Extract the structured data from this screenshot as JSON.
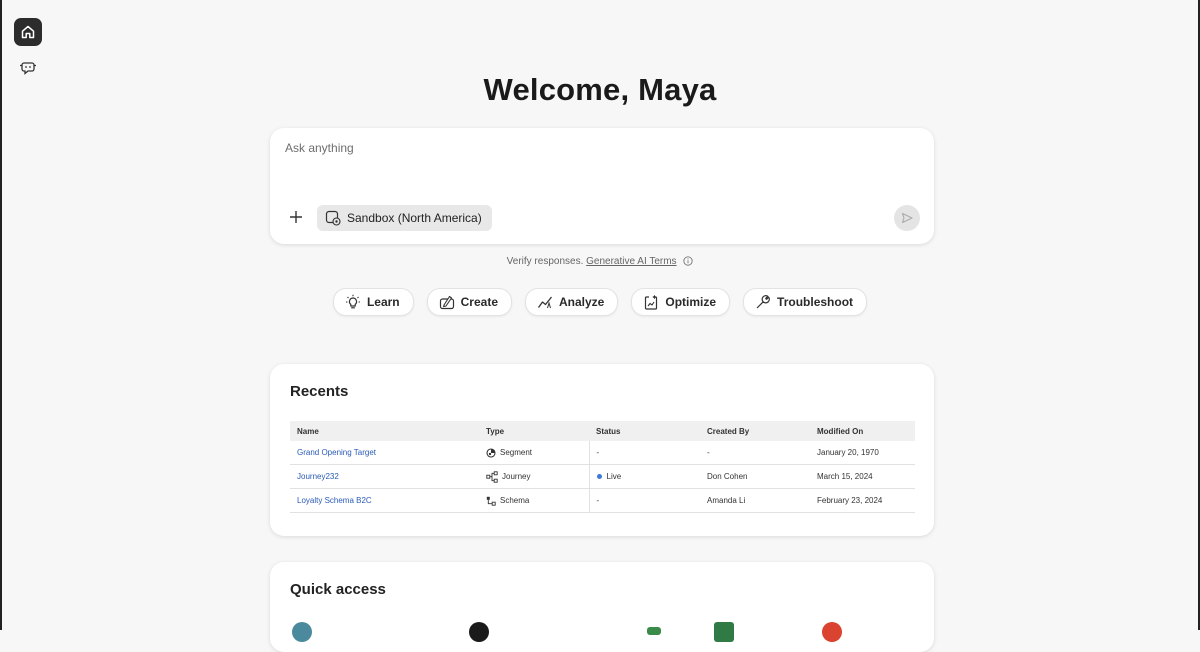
{
  "rail": {
    "items": [
      {
        "icon": "home-icon",
        "active": true
      },
      {
        "icon": "assistant-icon",
        "active": false
      }
    ]
  },
  "welcome": "Welcome, Maya",
  "ask": {
    "placeholder": "Ask anything",
    "sandbox_label": "Sandbox (North America)"
  },
  "verify": {
    "text": "Verify responses.",
    "link": "Generative AI Terms"
  },
  "pills": [
    {
      "label": "Learn",
      "icon": "lightbulb-icon"
    },
    {
      "label": "Create",
      "icon": "create-icon"
    },
    {
      "label": "Analyze",
      "icon": "analyze-icon"
    },
    {
      "label": "Optimize",
      "icon": "optimize-icon"
    },
    {
      "label": "Troubleshoot",
      "icon": "wrench-icon"
    }
  ],
  "recents": {
    "title": "Recents",
    "columns": [
      "Name",
      "Type",
      "Status",
      "Created By",
      "Modified On"
    ],
    "rows": [
      {
        "name": "Grand Opening Target",
        "type": "Segment",
        "type_icon": "segment-icon",
        "status": "-",
        "created_by": "-",
        "modified_on": "January 20, 1970"
      },
      {
        "name": "Journey232",
        "type": "Journey",
        "type_icon": "journey-icon",
        "status": "Live",
        "created_by": "Don Cohen",
        "modified_on": "March 15, 2024"
      },
      {
        "name": "Loyalty Schema B2C",
        "type": "Schema",
        "type_icon": "schema-icon",
        "status": "-",
        "created_by": "Amanda Li",
        "modified_on": "February 23, 2024"
      }
    ]
  },
  "quick_access": {
    "title": "Quick access"
  },
  "colors": {
    "link": "#2a5bb8",
    "live_dot": "#3b7ad6",
    "rail_active": "#2c2c2c"
  }
}
